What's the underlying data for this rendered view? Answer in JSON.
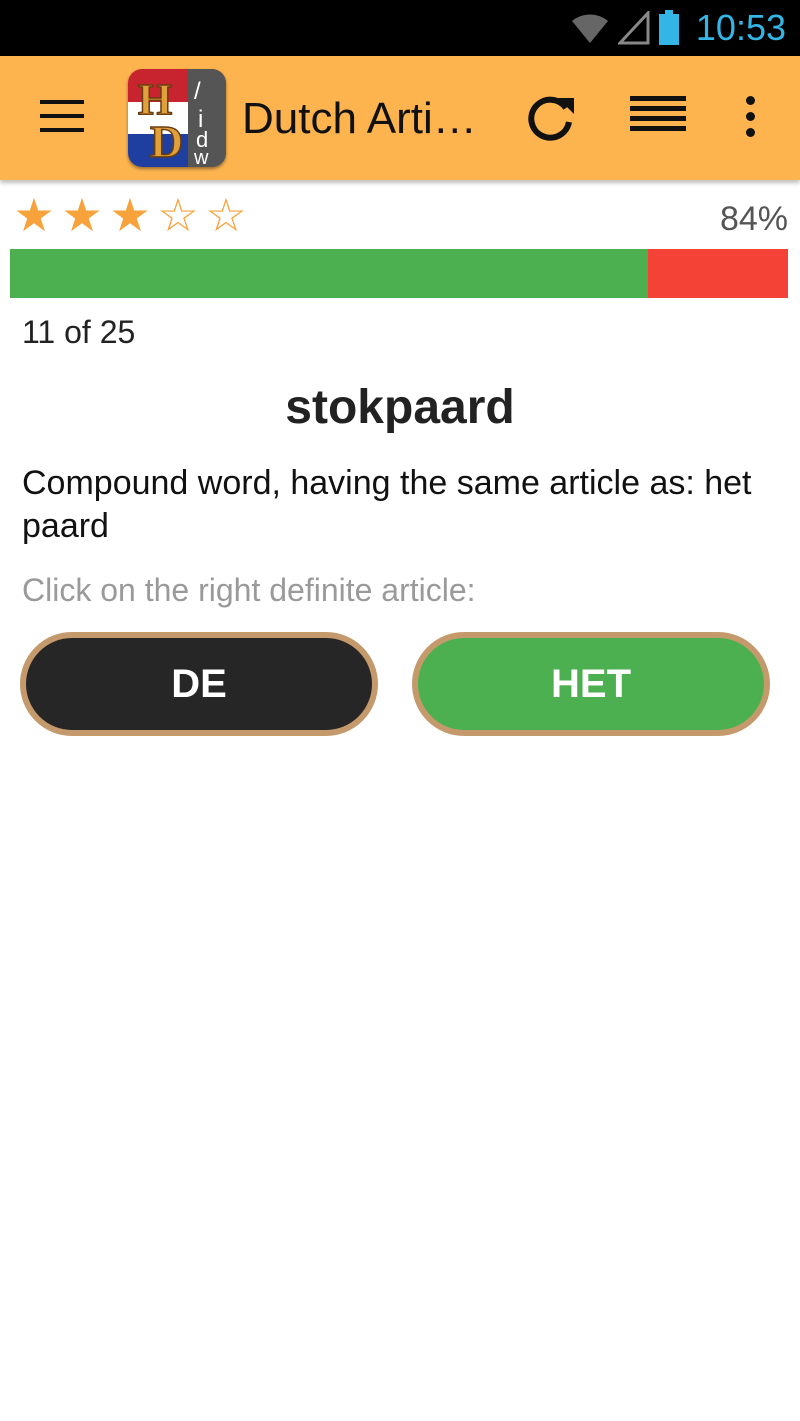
{
  "status_bar": {
    "time": "10:53",
    "icons": [
      "wifi-icon",
      "signal-icon",
      "battery-icon"
    ]
  },
  "app_bar": {
    "title": "Dutch Arti…",
    "logo_text": "HD/idw",
    "icons": [
      "menu-icon",
      "refresh-icon",
      "list-icon",
      "overflow-menu-icon"
    ],
    "background_color": "#fdb44e"
  },
  "score": {
    "stars_filled": 3,
    "stars_total": 5,
    "percent_text": "84%",
    "progress_fraction": 0.82,
    "correct_color": "#4caf50",
    "wrong_color": "#f44336"
  },
  "quiz": {
    "counter": "11 of 25",
    "word": "stokpaard",
    "hint": "Compound word, having the same article as: het paard",
    "instruction": "Click on the right definite article:",
    "buttons": {
      "de_label": "DE",
      "het_label": "HET"
    }
  }
}
